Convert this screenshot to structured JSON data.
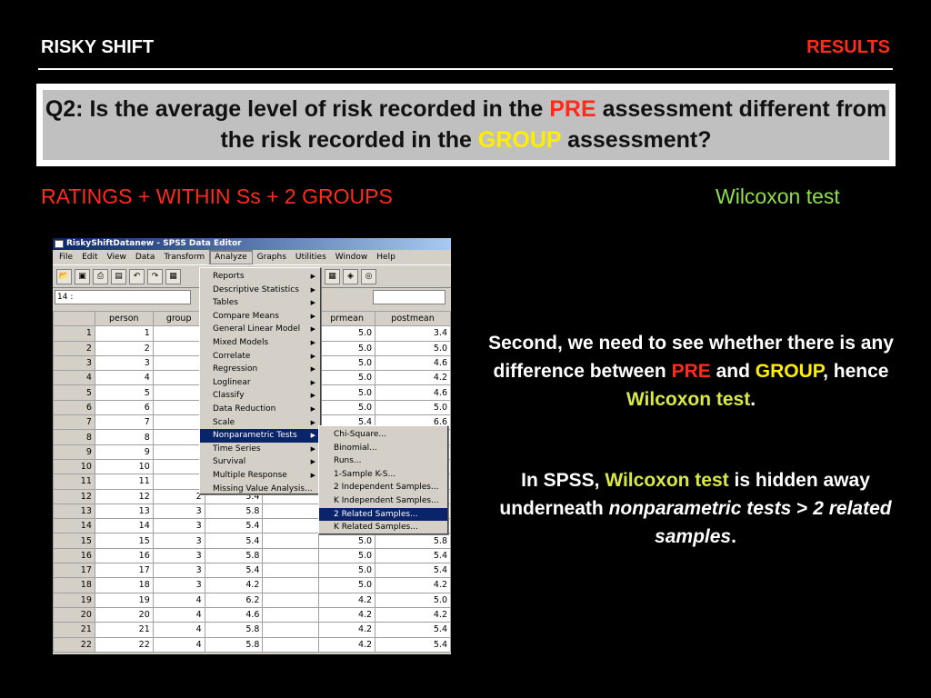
{
  "header": {
    "left_title": "RISKY SHIFT",
    "right_title": "RESULTS"
  },
  "question": {
    "part1": "Q2: Is the average level of risk recorded in the ",
    "pre": "PRE",
    "part2": " assessment different from the risk recorded in the ",
    "group": "GROUP",
    "part3": " assessment?"
  },
  "left_label": "RATINGS + WITHIN Ss + 2 GROUPS",
  "right_label": "Wilcoxon test",
  "para1": {
    "t1": "Second, we need to see whether there is any difference between ",
    "pre": "PRE",
    "t2": " and ",
    "group": "GROUP",
    "t3": ", hence ",
    "wilcoxon": "Wilcoxon test",
    "t4": "."
  },
  "para2": {
    "t1": "In SPSS, ",
    "wilcoxon": "Wilcoxon test",
    "t2": " is hidden away underneath ",
    "italic1": "nonparametric tests",
    "t3": " > ",
    "italic2": "2 related samples",
    "t4": "."
  },
  "spss": {
    "title": "RiskyShiftDatanew - SPSS Data Editor",
    "menubar": [
      "File",
      "Edit",
      "View",
      "Data",
      "Transform",
      "Analyze",
      "Graphs",
      "Utilities",
      "Window",
      "Help"
    ],
    "cell_ref": "14 :",
    "columns": [
      "",
      "person",
      "group",
      "",
      "",
      "prmean",
      "postmean"
    ],
    "rows": [
      [
        "1",
        "1",
        "",
        "",
        "",
        "5.0",
        "3.4"
      ],
      [
        "2",
        "2",
        "",
        "",
        "",
        "5.0",
        "5.0"
      ],
      [
        "3",
        "3",
        "",
        "",
        "",
        "5.0",
        "4.6"
      ],
      [
        "4",
        "4",
        "",
        "",
        "",
        "5.0",
        "4.2"
      ],
      [
        "5",
        "5",
        "",
        "",
        "",
        "5.0",
        "4.6"
      ],
      [
        "6",
        "6",
        "",
        "",
        "",
        "5.0",
        "5.0"
      ],
      [
        "7",
        "7",
        "",
        "",
        "",
        "5.4",
        "6.6"
      ],
      [
        "8",
        "8",
        "",
        "",
        "",
        "",
        ""
      ],
      [
        "9",
        "9",
        "",
        "",
        "",
        "",
        ""
      ],
      [
        "10",
        "10",
        "",
        "",
        "",
        "",
        ""
      ],
      [
        "11",
        "11",
        "",
        "",
        "",
        "",
        ""
      ],
      [
        "12",
        "12",
        "2",
        "5.4",
        "",
        "",
        ""
      ],
      [
        "13",
        "13",
        "3",
        "5.8",
        "",
        "",
        ""
      ],
      [
        "14",
        "14",
        "3",
        "5.4",
        "",
        "",
        ""
      ],
      [
        "15",
        "15",
        "3",
        "5.4",
        "",
        "5.0",
        "5.8"
      ],
      [
        "16",
        "16",
        "3",
        "5.8",
        "",
        "5.0",
        "5.4"
      ],
      [
        "17",
        "17",
        "3",
        "5.4",
        "",
        "5.0",
        "5.4"
      ],
      [
        "18",
        "18",
        "3",
        "4.2",
        "",
        "5.0",
        "4.2"
      ],
      [
        "19",
        "19",
        "4",
        "6.2",
        "",
        "4.2",
        "5.0"
      ],
      [
        "20",
        "20",
        "4",
        "4.6",
        "",
        "4.2",
        "4.2"
      ],
      [
        "21",
        "21",
        "4",
        "5.8",
        "",
        "4.2",
        "5.4"
      ],
      [
        "22",
        "22",
        "4",
        "5.8",
        "",
        "4.2",
        "5.4"
      ]
    ],
    "analyze_menu": [
      "Reports",
      "Descriptive Statistics",
      "Tables",
      "Compare Means",
      "General Linear Model",
      "Mixed Models",
      "Correlate",
      "Regression",
      "Loglinear",
      "Classify",
      "Data Reduction",
      "Scale",
      "Nonparametric Tests",
      "Time Series",
      "Survival",
      "Multiple Response",
      "Missing Value Analysis..."
    ],
    "analyze_has_submenu": [
      true,
      true,
      true,
      true,
      true,
      true,
      true,
      true,
      true,
      true,
      true,
      true,
      true,
      true,
      true,
      true,
      false
    ],
    "analyze_selected": 12,
    "nonparam_menu": [
      "Chi-Square...",
      "Binomial...",
      "Runs...",
      "1-Sample K-S...",
      "2 Independent Samples...",
      "K Independent Samples...",
      "2 Related Samples...",
      "K Related Samples..."
    ],
    "nonparam_selected": 6
  },
  "colors": {
    "red": "#ff2a1a",
    "yellow": "#ffee00",
    "green": "#8fe046",
    "highlight": "#0a246a"
  }
}
